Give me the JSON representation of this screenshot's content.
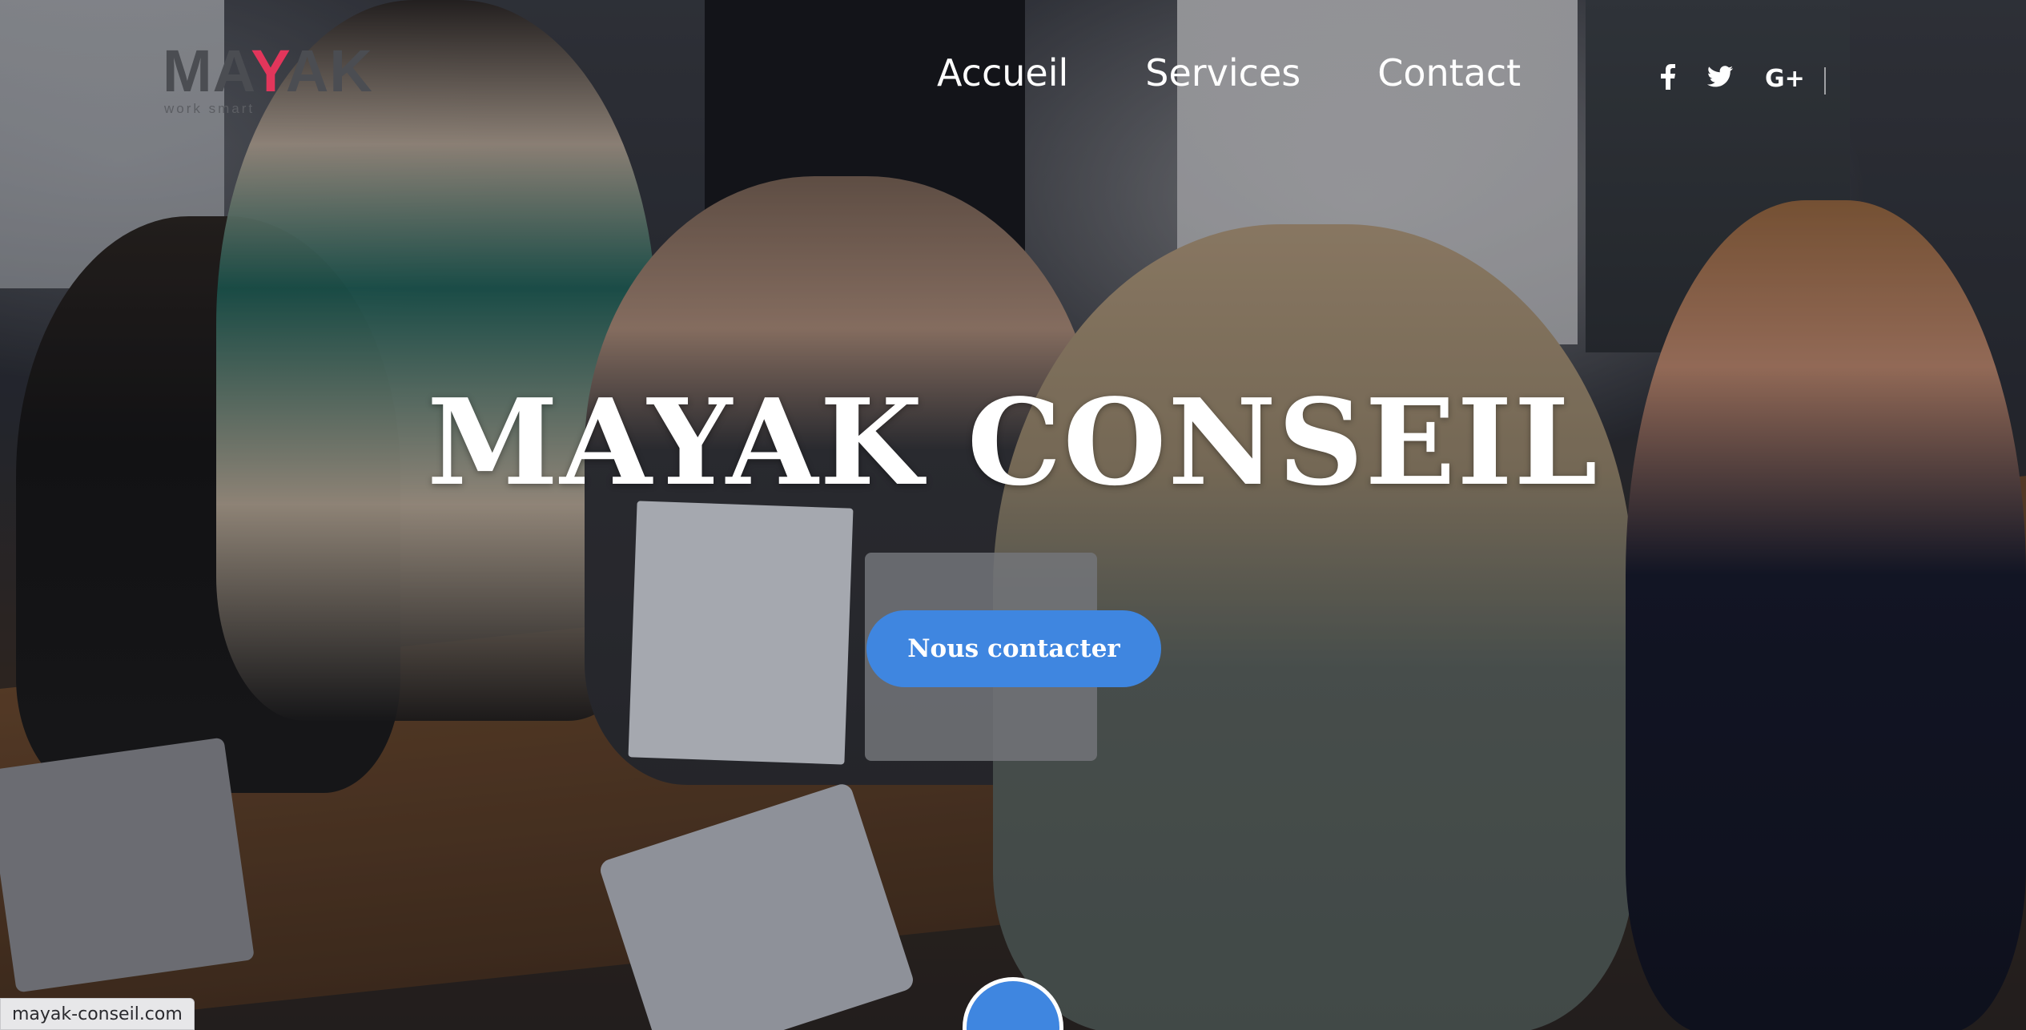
{
  "brand": {
    "logo_text_start": "MA",
    "logo_text_accent": "Y",
    "logo_text_end": "AK",
    "tagline": "work smart",
    "accent_color": "#e2365b",
    "logo_color": "#4b4d52"
  },
  "nav": {
    "items": [
      {
        "label": "Accueil"
      },
      {
        "label": "Services"
      },
      {
        "label": "Contact"
      }
    ]
  },
  "social": {
    "icons": [
      {
        "name": "facebook-icon",
        "glyph": "f"
      },
      {
        "name": "twitter-icon",
        "glyph": "🐦"
      },
      {
        "name": "google-plus-icon",
        "glyph": "G+"
      }
    ]
  },
  "hero": {
    "title": "MAYAK CONSEIL",
    "cta_label": "Nous contacter",
    "cta_color": "#3f86e0",
    "scroll_icon": "chevron-down-icon"
  },
  "status_bar": {
    "url": "mayak-conseil.com"
  }
}
